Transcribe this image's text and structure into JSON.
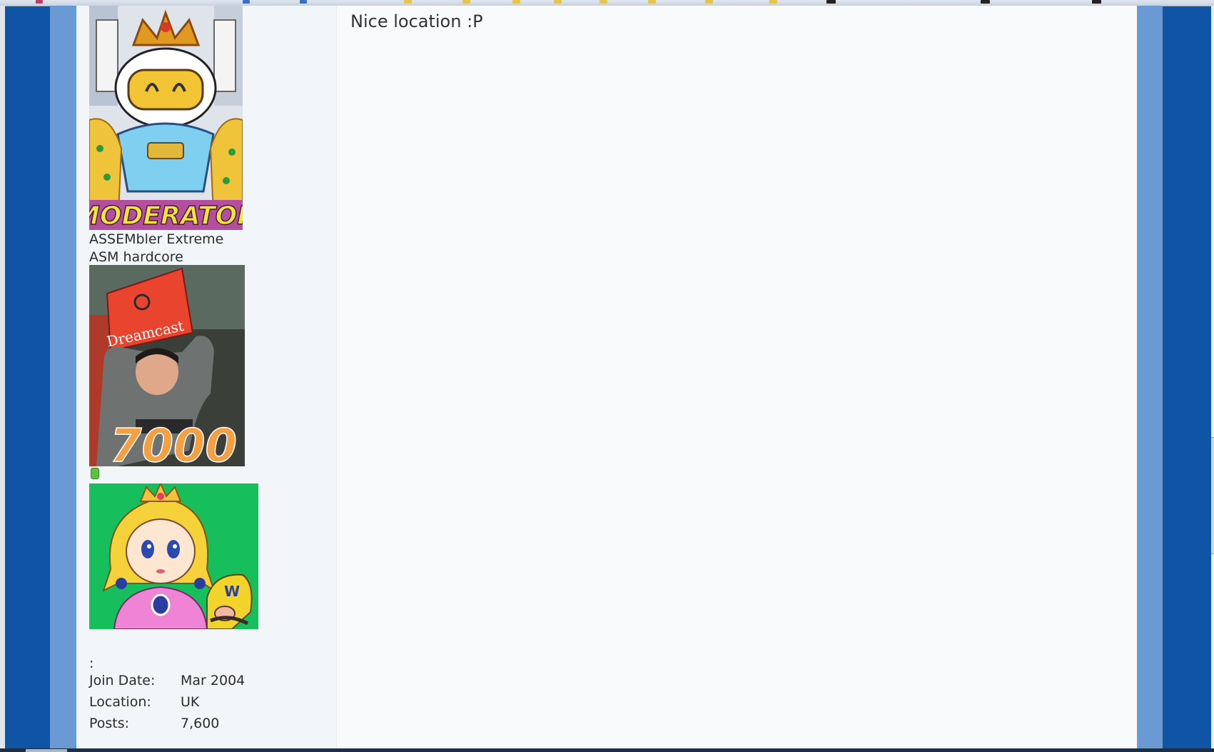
{
  "post": {
    "message": "Nice location :P"
  },
  "sidebar": {
    "rank_image": {
      "icon": "moderator-rank-image",
      "caption": "MODERATOR"
    },
    "user_title_line1": "ASSEMbler Extreme",
    "user_title_line2": "ASM hardcore",
    "post_count_badge": {
      "icon": "dreamcast-badge-image",
      "caption": "7000",
      "box_text": "Dreamcast"
    },
    "online_status": {
      "icon": "online-status-icon",
      "color": "#5cc23c"
    },
    "avatar": {
      "icon": "avatar-image",
      "background": "#16bf5c"
    },
    "separator": ":",
    "stats": [
      {
        "label": "Join Date:",
        "value": "Mar 2004"
      },
      {
        "label": "Location:",
        "value": "UK"
      },
      {
        "label": "Posts:",
        "value": "7,600"
      }
    ]
  },
  "colors": {
    "outer_background": "#0f54a5",
    "frame": "#6a9ad4",
    "page": "#f9fafb",
    "sidebar": "#f2f6f9"
  }
}
